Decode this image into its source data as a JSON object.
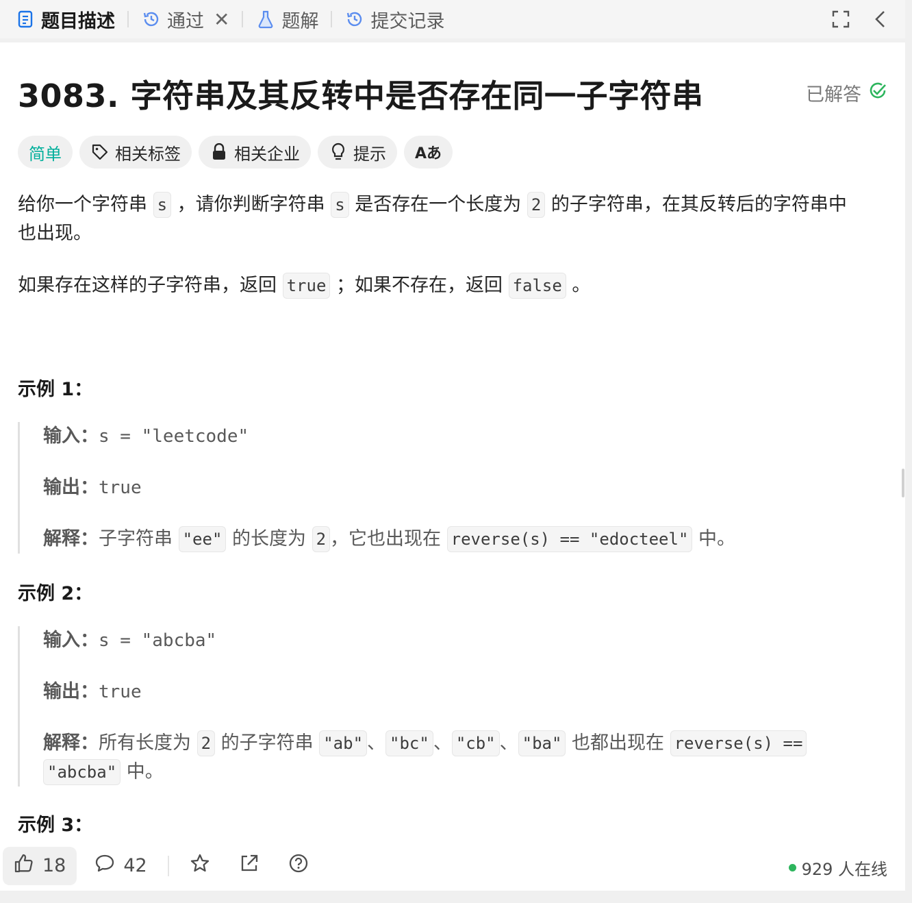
{
  "tabs": [
    {
      "label": "题目描述",
      "icon": "document-icon",
      "active": true
    },
    {
      "label": "通过",
      "icon": "history-icon"
    },
    {
      "label": "题解",
      "icon": "flask-icon"
    },
    {
      "label": "提交记录",
      "icon": "history-icon"
    }
  ],
  "problem": {
    "title": "3083. 字符串及其反转中是否存在同一子字符串",
    "status": "已解答"
  },
  "chips": {
    "difficulty": "简单",
    "tags": "相关标签",
    "companies": "相关企业",
    "hint": "提示",
    "translate": "Aあ"
  },
  "description": {
    "p1": {
      "t1": "给你一个字符串",
      "c1": "s",
      "t2": "，请你判断字符串",
      "c2": "s",
      "t3": "是否存在一个长度为",
      "c3": "2",
      "t4": "的子字符串，在其反转后的字符串中",
      "t5": "也出现。"
    },
    "p2": {
      "t1": "如果存在这样的子字符串，返回",
      "c1": "true",
      "t2": "；如果不存在，返回",
      "c2": "false",
      "t3": "。"
    }
  },
  "examples": [
    {
      "title": "示例 1：",
      "input_label": "输入：",
      "input": "s = \"leetcode\"",
      "output_label": "输出：",
      "output": "true",
      "explain_label": "解释：",
      "explain": {
        "t1": "子字符串",
        "c1": "\"ee\"",
        "t2": "的长度为",
        "c2": "2",
        "t3": "，它也出现在",
        "c3": "reverse(s) == \"edocteel\"",
        "t4": "中。"
      }
    },
    {
      "title": "示例 2：",
      "input_label": "输入：",
      "input": "s = \"abcba\"",
      "output_label": "输出：",
      "output": "true",
      "explain_label": "解释：",
      "explain": {
        "t1": "所有长度为",
        "c1": "2",
        "t2": "的子字符串",
        "c2": "\"ab\"",
        "s1": "、",
        "c3": "\"bc\"",
        "s2": "、",
        "c4": "\"cb\"",
        "s3": "、",
        "c5": "\"ba\"",
        "t3": "也都出现在",
        "c6": "reverse(s) ==",
        "c7": "\"abcba\"",
        "t4": "中。"
      }
    },
    {
      "title": "示例 3："
    }
  ],
  "bottom": {
    "likes": "18",
    "comments": "42",
    "online": "929 人在线"
  },
  "colors": {
    "easy": "#00af9b",
    "solved_check": "#2db55d",
    "online_dot": "#2db55d"
  }
}
